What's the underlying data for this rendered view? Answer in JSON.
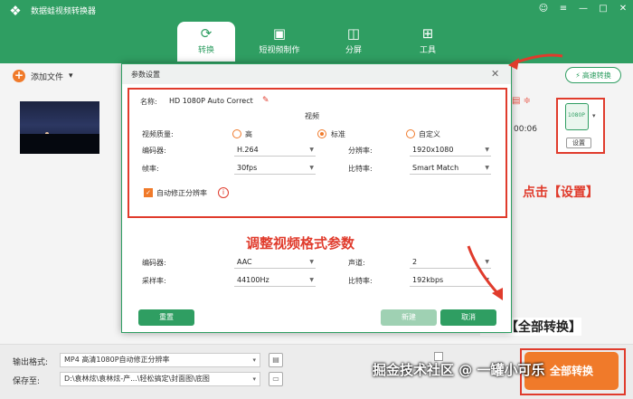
{
  "app": {
    "title": "数据蛙视频转换器"
  },
  "window_controls": [
    "☺",
    "≡",
    "—",
    "□",
    "✕"
  ],
  "tabs": [
    {
      "label": "转换",
      "icon": "convert-icon",
      "active": true
    },
    {
      "label": "短视频制作",
      "icon": "image-icon",
      "active": false
    },
    {
      "label": "分屏",
      "icon": "split-screen-icon",
      "active": false
    },
    {
      "label": "工具",
      "icon": "toolbox-icon",
      "active": false
    }
  ],
  "toolbar": {
    "add_file": "添加文件",
    "speed_button": "高速转换"
  },
  "file": {
    "time_fragment": "00:06"
  },
  "dialog": {
    "title": "参数设置",
    "name_label": "名称:",
    "name_value": "HD 1080P Auto Correct",
    "video_section": "视频",
    "quality_label": "视频质量:",
    "quality_options": [
      "高",
      "标准",
      "自定义"
    ],
    "quality_selected": "标准",
    "encoder_label": "编码器:",
    "encoder_value": "H.264",
    "resolution_label": "分辨率:",
    "resolution_value": "1920x1080",
    "framerate_label": "帧率:",
    "framerate_value": "30fps",
    "bitrate_label": "比特率:",
    "bitrate_value": "Smart Match",
    "auto_fix_label": "自动修正分辨率",
    "audio_encoder_label": "编码器:",
    "audio_encoder_value": "AAC",
    "channel_label": "声道:",
    "channel_value": "2",
    "sample_rate_label": "采样率:",
    "sample_rate_value": "44100Hz",
    "audio_bitrate_label": "比特率:",
    "audio_bitrate_value": "192kbps",
    "reset_button": "重置",
    "create_button": "新建",
    "cancel_button": "取消"
  },
  "settings_panel": {
    "label": "设置",
    "icon_text": "1080P"
  },
  "annotations": {
    "settings": "点击【设置】",
    "adjust": "调整视频格式参数",
    "convert_all": "点击【全部转换】"
  },
  "bottom": {
    "output_format_label": "输出格式:",
    "output_format_value": "MP4 高清1080P自动修正分辨率",
    "save_to_label": "保存至:",
    "save_to_value": "D:\\袁林炫\\袁林炫-产...\\轻松搞定\\封面图\\底图",
    "convert_all_button": "全部转换",
    "watermark": "掘金技术社区 @ 一罐小可乐"
  },
  "colors": {
    "brand_green": "#2f9e62",
    "accent_orange": "#f07a2a",
    "annotation_red": "#e03b2c"
  }
}
